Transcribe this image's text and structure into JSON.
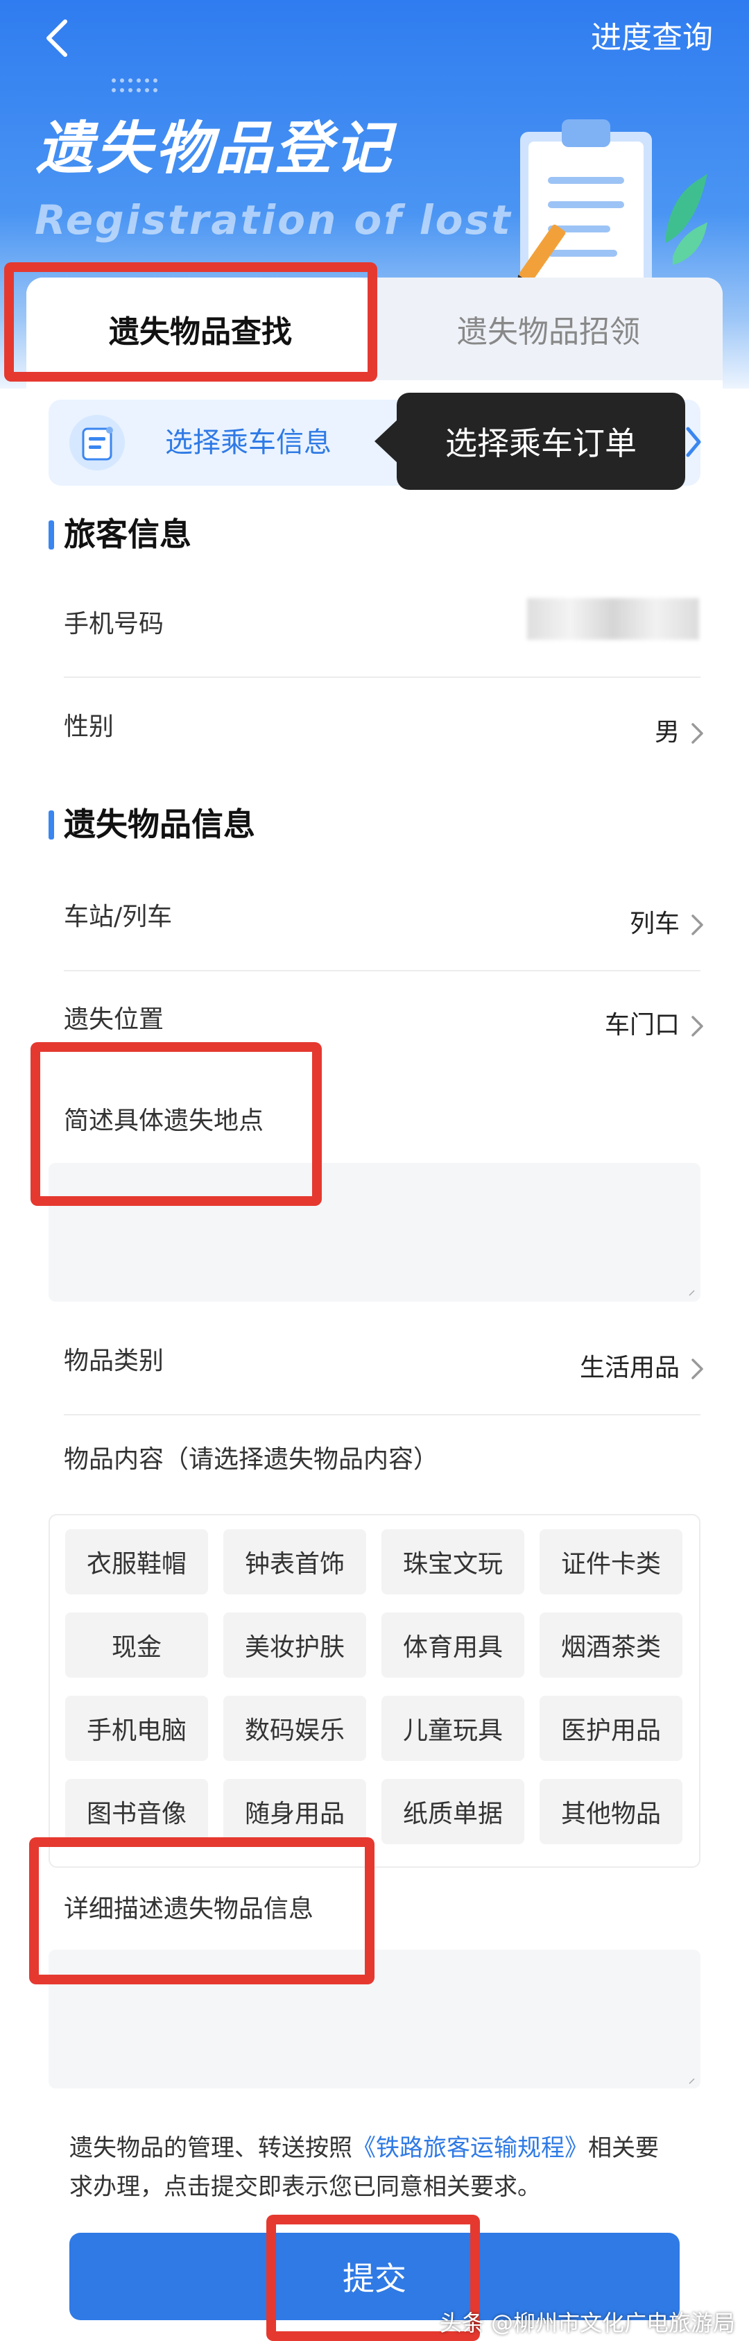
{
  "header": {
    "progress_link": "进度查询",
    "title_cn": "遗失物品登记",
    "title_en": "Registration of lost"
  },
  "tabs": [
    {
      "label": "遗失物品查找",
      "active": true
    },
    {
      "label": "遗失物品招领",
      "active": false
    }
  ],
  "trip": {
    "label": "选择乘车信息",
    "tooltip": "选择乘车订单"
  },
  "passenger": {
    "section_title": "旅客信息",
    "phone_label": "手机号码",
    "gender_label": "性别",
    "gender_value": "男"
  },
  "lost_item": {
    "section_title": "遗失物品信息",
    "station_label": "车站/列车",
    "station_value": "列车",
    "location_label": "遗失位置",
    "location_value": "车门口",
    "place_desc_label": "简述具体遗失地点",
    "category_label": "物品类别",
    "category_value": "生活用品",
    "content_label": "物品内容（请选择遗失物品内容）",
    "detail_label": "详细描述遗失物品信息"
  },
  "item_options": [
    "衣服鞋帽",
    "钟表首饰",
    "珠宝文玩",
    "证件卡类",
    "现金",
    "美妆护肤",
    "体育用具",
    "烟酒茶类",
    "手机电脑",
    "数码娱乐",
    "儿童玩具",
    "医护用品",
    "图书音像",
    "随身用品",
    "纸质单据",
    "其他物品"
  ],
  "notice": {
    "prefix": "遗失物品的管理、转送按照",
    "link": "《铁路旅客运输规程》",
    "suffix": "相关要求办理，点击提交即表示您已同意相关要求。"
  },
  "submit_label": "提交",
  "watermark": "头条 @柳州市文化广电旅游局",
  "colors": {
    "primary": "#2f7ae5",
    "annotation_red": "#e53930",
    "tooltip_bg": "#242424"
  }
}
